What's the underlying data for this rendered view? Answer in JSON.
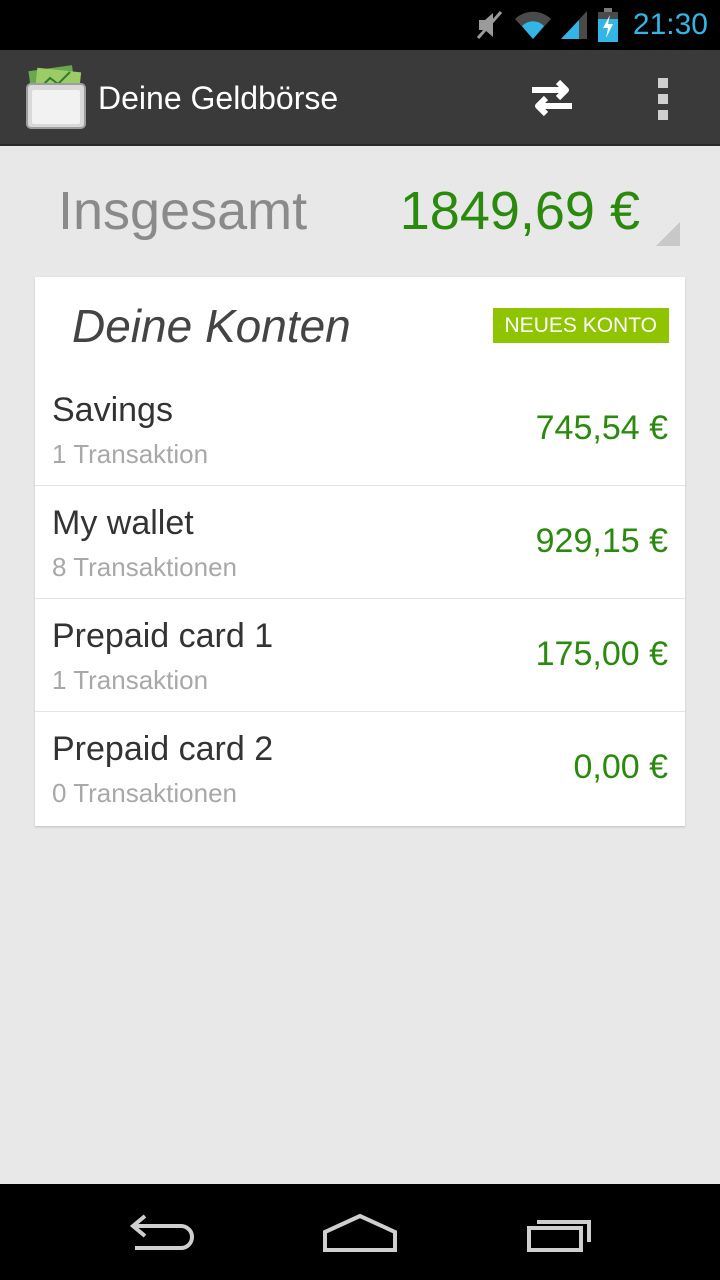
{
  "status_bar": {
    "time": "21:30",
    "icons": [
      "mute-icon",
      "wifi-icon",
      "signal-icon",
      "battery-charging-icon"
    ],
    "accent_color": "#33b5e5"
  },
  "action_bar": {
    "title": "Deine Geldbörse",
    "icons": [
      "wallet-app-icon",
      "swap-arrows-icon",
      "overflow-menu-icon"
    ]
  },
  "total": {
    "label": "Insgesamt",
    "value": "1849,69 €",
    "value_color": "#2a8a0e"
  },
  "accounts_card": {
    "title": "Deine Konten",
    "new_account_label": "NEUES KONTO",
    "button_color": "#8fc400",
    "accounts": [
      {
        "name": "Savings",
        "count": "1 Transaktion",
        "balance": "745,54 €"
      },
      {
        "name": "My wallet",
        "count": "8 Transaktionen",
        "balance": "929,15 €"
      },
      {
        "name": "Prepaid card 1",
        "count": "1 Transaktion",
        "balance": "175,00 €"
      },
      {
        "name": "Prepaid card 2",
        "count": "0 Transaktionen",
        "balance": "0,00 €"
      }
    ]
  },
  "nav_bar": {
    "icons": [
      "back-icon",
      "home-icon",
      "recent-apps-icon"
    ]
  }
}
